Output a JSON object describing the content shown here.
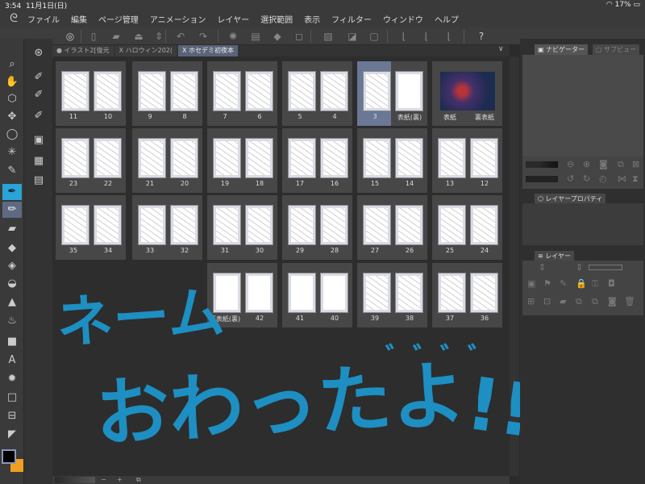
{
  "status": {
    "time": "3:54",
    "date": "11月1日(日)",
    "wifi_icon": "wifi-icon",
    "battery": "17%"
  },
  "menu": [
    "ファイル",
    "編集",
    "ページ管理",
    "アニメーション",
    "レイヤー",
    "選択範囲",
    "表示",
    "フィルター",
    "ウィンドウ",
    "ヘルプ"
  ],
  "toolbar": [
    "clip-studio-icon",
    "new-page-icon",
    "open-icon",
    "export-icon",
    "stepper-icon",
    "undo-icon",
    "redo-icon",
    "loading-icon",
    "copy-icon",
    "fill-icon",
    "crop-icon",
    "clear-icon",
    "fill-selection-icon",
    "mask-icon",
    "pen-icon",
    "brush-icon",
    "pencil-icon",
    "help-icon"
  ],
  "tabs": [
    {
      "label": "● イラスト2[復元",
      "active": false
    },
    {
      "label": "X ハロウィン202(",
      "active": false
    },
    {
      "label": "X ホセデミ初夜本",
      "active": true
    }
  ],
  "tools": [
    {
      "icon": "zoom-icon",
      "glyph": "⌕"
    },
    {
      "icon": "hand-icon",
      "glyph": "✋"
    },
    {
      "icon": "object-icon",
      "glyph": "⬡"
    },
    {
      "icon": "move-icon",
      "glyph": "✥"
    },
    {
      "icon": "lasso-icon",
      "glyph": "◯"
    },
    {
      "icon": "magic-wand-icon",
      "glyph": "✳"
    },
    {
      "icon": "eyedropper-icon",
      "glyph": "✎"
    },
    {
      "icon": "pen-icon",
      "glyph": "✒",
      "state": "active"
    },
    {
      "icon": "pencil-icon",
      "glyph": "✏",
      "state": "sel"
    },
    {
      "icon": "airbrush-icon",
      "glyph": "▰"
    },
    {
      "icon": "eraser-icon",
      "glyph": "◆"
    },
    {
      "icon": "fill-icon",
      "glyph": "◈"
    },
    {
      "icon": "blend-icon",
      "glyph": "◒"
    },
    {
      "icon": "decoration-icon",
      "glyph": "▲"
    },
    {
      "icon": "gradient-drops-icon",
      "glyph": "♨"
    },
    {
      "icon": "gradient-icon",
      "glyph": "■"
    },
    {
      "icon": "text-icon",
      "glyph": "A"
    },
    {
      "icon": "balloon-icon",
      "glyph": "✹"
    },
    {
      "icon": "figure-icon",
      "glyph": "□"
    },
    {
      "icon": "frame-icon",
      "glyph": "⊟"
    },
    {
      "icon": "ruler-icon",
      "glyph": "◤"
    }
  ],
  "subtools": [
    {
      "icon": "sub-tool-icon",
      "glyph": "⊛"
    },
    {
      "icon": "pen-list-icon",
      "glyph": "✐"
    },
    {
      "icon": "pen-settings-icon",
      "glyph": "✐"
    },
    {
      "icon": "pen-material-icon",
      "glyph": "✐"
    },
    {
      "icon": "layer-icon",
      "glyph": "▣"
    },
    {
      "icon": "color-set-icon",
      "glyph": "▦"
    },
    {
      "icon": "timeline-icon",
      "glyph": "▤"
    }
  ],
  "spreads": [
    [
      {
        "pages": [
          "11",
          "10"
        ]
      },
      {
        "pages": [
          "9",
          "8"
        ]
      },
      {
        "pages": [
          "7",
          "6"
        ]
      },
      {
        "pages": [
          "5",
          "4"
        ]
      },
      {
        "pages": [
          "3",
          "表紙(裏)"
        ],
        "selected": true,
        "blank": [
          false,
          true
        ]
      },
      {
        "pages": [
          "表紙",
          "裏表紙"
        ],
        "cover": true
      }
    ],
    [
      {
        "pages": [
          "23",
          "22"
        ]
      },
      {
        "pages": [
          "21",
          "20"
        ]
      },
      {
        "pages": [
          "19",
          "18"
        ]
      },
      {
        "pages": [
          "17",
          "16"
        ]
      },
      {
        "pages": [
          "15",
          "14"
        ]
      },
      {
        "pages": [
          "13",
          "12"
        ]
      }
    ],
    [
      {
        "pages": [
          "35",
          "34"
        ]
      },
      {
        "pages": [
          "33",
          "32"
        ]
      },
      {
        "pages": [
          "31",
          "30"
        ]
      },
      {
        "pages": [
          "29",
          "28"
        ]
      },
      {
        "pages": [
          "27",
          "26"
        ]
      },
      {
        "pages": [
          "25",
          "24"
        ]
      }
    ],
    [
      null,
      null,
      {
        "pages": [
          "裏表紙(裏)",
          "42"
        ],
        "blank": [
          true,
          true
        ]
      },
      {
        "pages": [
          "41",
          "40"
        ],
        "blank": [
          true,
          true
        ]
      },
      {
        "pages": [
          "39",
          "38"
        ]
      },
      {
        "pages": [
          "37",
          "36"
        ]
      }
    ]
  ],
  "handwriting": {
    "line1": "ネーム",
    "line2": "おわったよ",
    "dakuten": "゛゛゛゛",
    "exclaim": "!!!!",
    "color": "#1d8fc2"
  },
  "right": {
    "navigator": "ナビゲーター",
    "subview": "サブビュー",
    "layer_property": "レイヤープロパティ",
    "layer": "レイヤー"
  },
  "colors": {
    "main": "#000000",
    "sub": "#f0a020",
    "accent": "#2aa3d6"
  },
  "bottom": {
    "minus": "−",
    "plus": "+"
  }
}
